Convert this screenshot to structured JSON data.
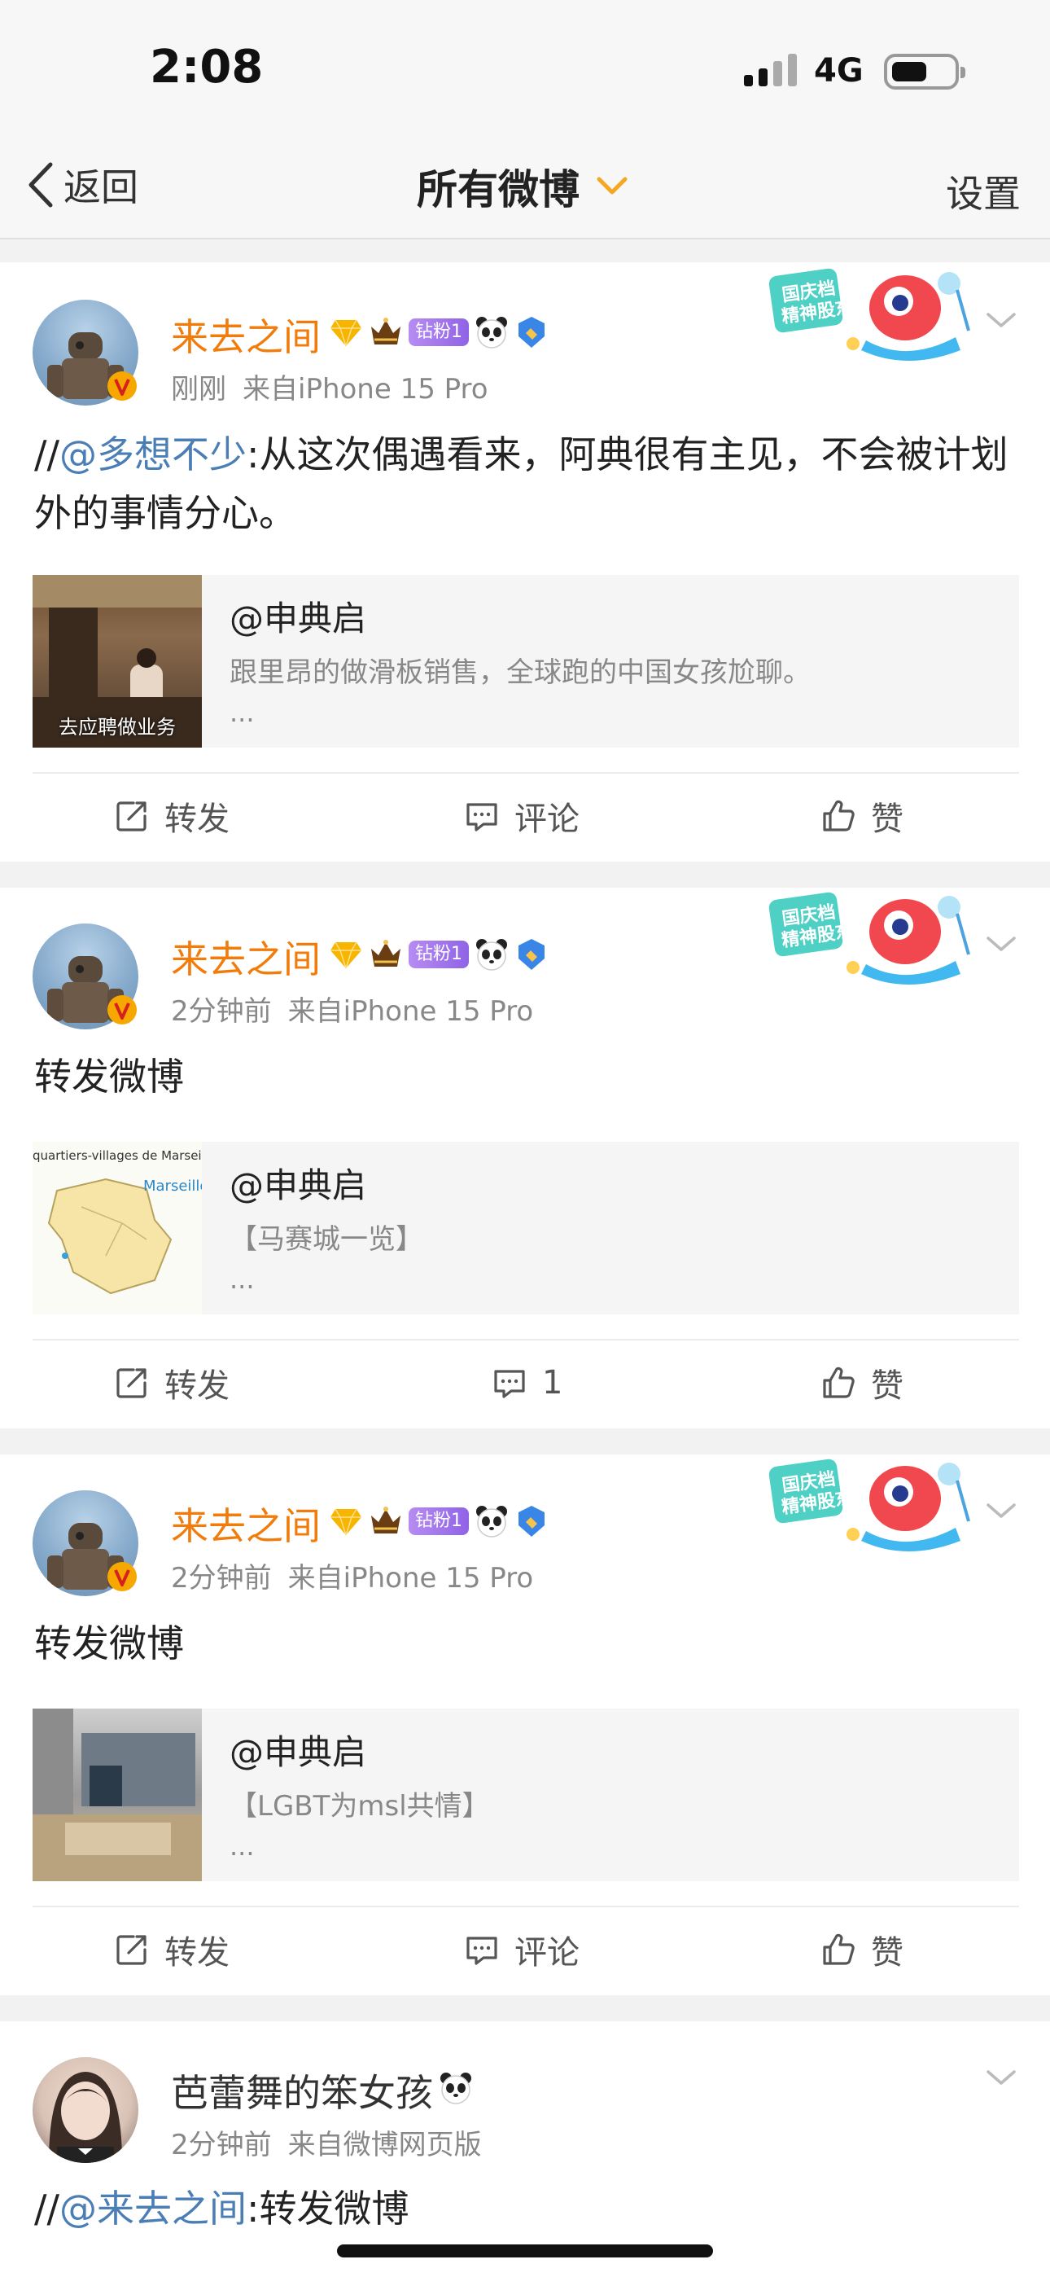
{
  "status_bar": {
    "time": "2:08",
    "network": "4G"
  },
  "nav": {
    "back_label": "返回",
    "title": "所有微博",
    "settings_label": "设置"
  },
  "icons": {
    "back": "chevron-left-icon",
    "dropdown": "chevron-down-icon",
    "repost": "share-edit-icon",
    "comment": "comment-icon",
    "like": "thumbs-up-icon",
    "more": "chevron-down-icon",
    "verified": "verified-v-icon",
    "vip": "vip-diamond-icon",
    "crown": "crown-icon",
    "panda": "panda-icon",
    "blue_badge": "blue-badge-icon",
    "promo": "national-day-banner-icon"
  },
  "colors": {
    "username": "#f17c0b",
    "mention": "#4a7eb5",
    "accent": "#f5a623",
    "muted": "#888888"
  },
  "posts": [
    {
      "username": "来去之间",
      "fan_badge": "钻粉1",
      "time": "刚刚",
      "source": "来自iPhone 15 Pro",
      "text_prefix": "//",
      "text_mention": "@多想不少",
      "text_body": ":从这次偶遇看来，阿典很有主见，不会被计划外的事情分心。",
      "quote": {
        "author": "@申典启",
        "text": "跟里昂的做滑板销售，全球跑的中国女孩尬聊。",
        "more": "...",
        "thumb_caption": "去应聘做业务"
      },
      "actions": {
        "repost": "转发",
        "comment": "评论",
        "like": "赞"
      }
    },
    {
      "username": "来去之间",
      "fan_badge": "钻粉1",
      "time": "2分钟前",
      "source": "来自iPhone 15 Pro",
      "text_body": "转发微博",
      "quote": {
        "author": "@申典启",
        "text": "【马赛城一览】",
        "more": "...",
        "thumb_caption": "quartiers-villages de Marseille",
        "thumb_map_label": "Marseille"
      },
      "actions": {
        "repost": "转发",
        "comment": "1",
        "like": "赞"
      }
    },
    {
      "username": "来去之间",
      "fan_badge": "钻粉1",
      "time": "2分钟前",
      "source": "来自iPhone 15 Pro",
      "text_body": "转发微博",
      "quote": {
        "author": "@申典启",
        "text": "【LGBT为msl共情】",
        "more": "..."
      },
      "actions": {
        "repost": "转发",
        "comment": "评论",
        "like": "赞"
      }
    },
    {
      "username": "芭蕾舞的笨女孩",
      "time": "2分钟前",
      "source": "来自微博网页版",
      "text_prefix": "//",
      "text_mention": "@来去之间",
      "text_body": ":转发微博"
    }
  ]
}
